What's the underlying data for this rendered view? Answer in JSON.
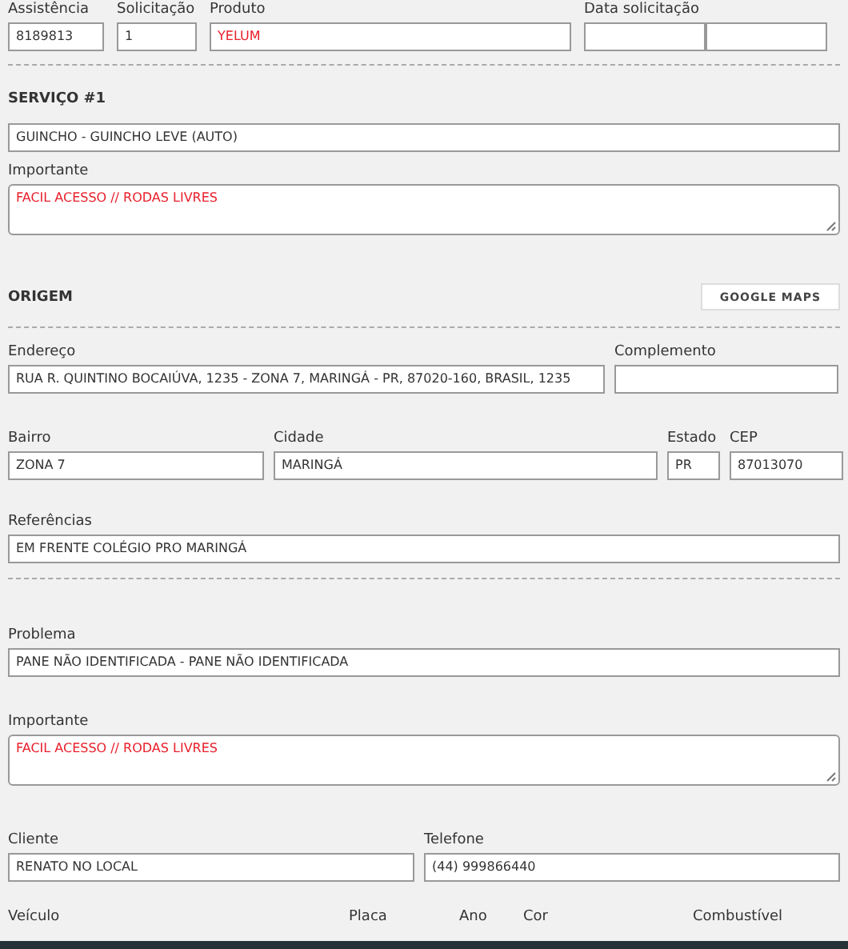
{
  "rows": [
    {
      "kind": "fields",
      "fields": [
        {
          "kind": "input",
          "label": "Assistência",
          "value": "8189813",
          "highlight": false
        },
        {
          "kind": "input",
          "label": "Solicitação",
          "value": "1",
          "highlight": false
        },
        {
          "kind": "input",
          "label": "Produto",
          "value": "YELUM",
          "highlight": true
        },
        {
          "kind": "split",
          "label": "Data solicitação"
        }
      ]
    },
    {
      "kind": "divider"
    },
    {
      "kind": "heading",
      "title": "SERVIÇO #1"
    },
    {
      "kind": "fields",
      "fields": [
        {
          "kind": "input",
          "value": "GUINCHO - GUINCHO LEVE (AUTO)",
          "highlight": false
        }
      ]
    },
    {
      "kind": "fields",
      "fields": [
        {
          "kind": "textarea",
          "label": "Importante",
          "value": "FACIL ACESSO // RODAS LIVRES",
          "highlight": true
        }
      ]
    },
    {
      "kind": "heading",
      "title": "ORIGEM",
      "button": "GOOGLE MAPS"
    },
    {
      "kind": "divider"
    },
    {
      "kind": "fields",
      "fields": [
        {
          "kind": "input",
          "label": "Endereço",
          "value": "RUA R. QUINTINO BOCAIÚVA, 1235 - ZONA 7, MARINGÁ - PR, 87020-160, BRASIL, 1235",
          "highlight": false
        },
        {
          "kind": "input",
          "label": "Complemento"
        }
      ]
    },
    {
      "kind": "fields",
      "fields": [
        {
          "kind": "input",
          "label": "Bairro",
          "value": "ZONA 7",
          "highlight": false
        },
        {
          "kind": "input",
          "label": "Cidade",
          "value": "MARINGÁ",
          "highlight": false
        },
        {
          "kind": "input",
          "label": "Estado",
          "value": "PR",
          "highlight": false
        },
        {
          "kind": "input",
          "label": "CEP",
          "value": "87013070",
          "highlight": false
        }
      ]
    },
    {
      "kind": "fields",
      "fields": [
        {
          "kind": "input",
          "label": "Referências",
          "value": "EM FRENTE COLÉGIO PRO MARINGÁ",
          "highlight": false
        }
      ]
    },
    {
      "kind": "divider"
    },
    {
      "kind": "fields",
      "fields": [
        {
          "kind": "input",
          "label": "Problema",
          "value": "PANE NÃO IDENTIFICADA - PANE NÃO IDENTIFICADA",
          "highlight": false
        }
      ]
    },
    {
      "kind": "fields",
      "fields": [
        {
          "kind": "textarea",
          "label": "Importante",
          "value": "FACIL ACESSO // RODAS LIVRES",
          "highlight": true
        }
      ]
    },
    {
      "kind": "fields",
      "fields": [
        {
          "kind": "input",
          "label": "Cliente",
          "value": "RENATO NO LOCAL",
          "highlight": false
        },
        {
          "kind": "input",
          "label": "Telefone",
          "value": "(44) 999866440",
          "highlight": false
        }
      ]
    },
    {
      "kind": "labels",
      "labels": [
        "Veículo",
        "Placa",
        "Ano",
        "Cor",
        "Combustível"
      ]
    }
  ]
}
